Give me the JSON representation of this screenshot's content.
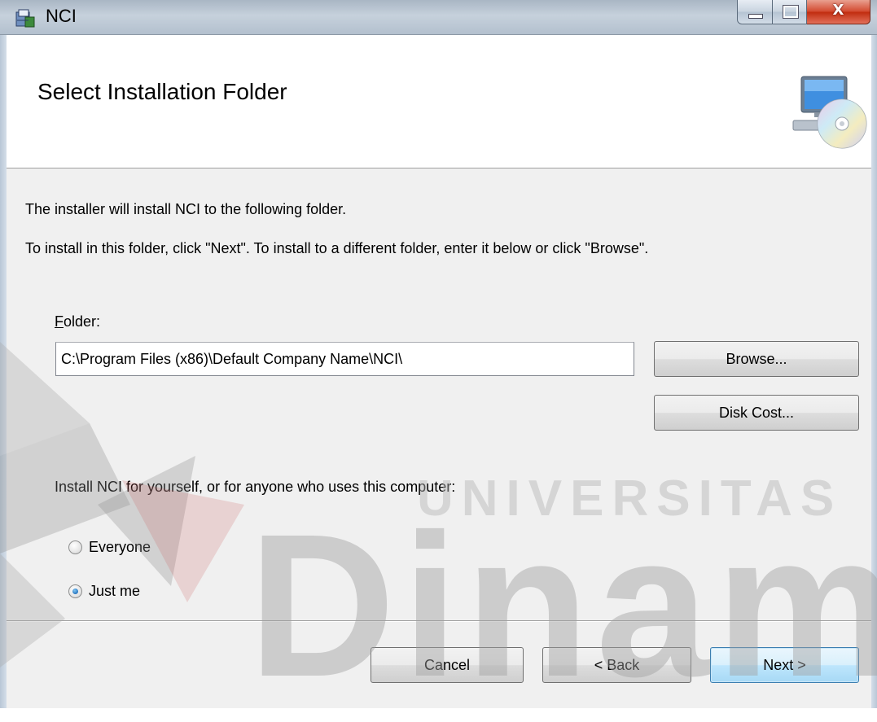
{
  "window": {
    "title": "NCI",
    "controls": [
      "minimize-icon",
      "maximize-icon",
      "close-icon"
    ],
    "close_glyph": "X"
  },
  "banner": {
    "title": "Select Installation Folder",
    "icon": "computer-cd-icon"
  },
  "content": {
    "line1": "The installer will install NCI to the following folder.",
    "line2": "To install in this folder, click \"Next\". To install to a different folder, enter it below or click \"Browse\".",
    "folder_label_accel": "F",
    "folder_label_rest": "older:",
    "folder_value": "C:\\Program Files (x86)\\Default Company Name\\NCI\\",
    "browse_label": "Browse...",
    "disk_cost_label": "Disk Cost...",
    "install_for_text": "Install NCI for yourself, or for anyone who uses this computer:",
    "radio_options": [
      {
        "label": "Everyone",
        "checked": false
      },
      {
        "label": "Just me",
        "checked": true
      }
    ]
  },
  "footer": {
    "cancel_label": "Cancel",
    "back_label": "< Back",
    "next_label": "Next >"
  },
  "watermark": {
    "line1": "UNIVERSITAS",
    "line2": "Dinamik"
  },
  "colors": {
    "titlebar": "#b9c7d6",
    "close_button": "#c8442a",
    "dialog_bg": "#f0f0f0",
    "default_button_border": "#3c7fb1"
  }
}
